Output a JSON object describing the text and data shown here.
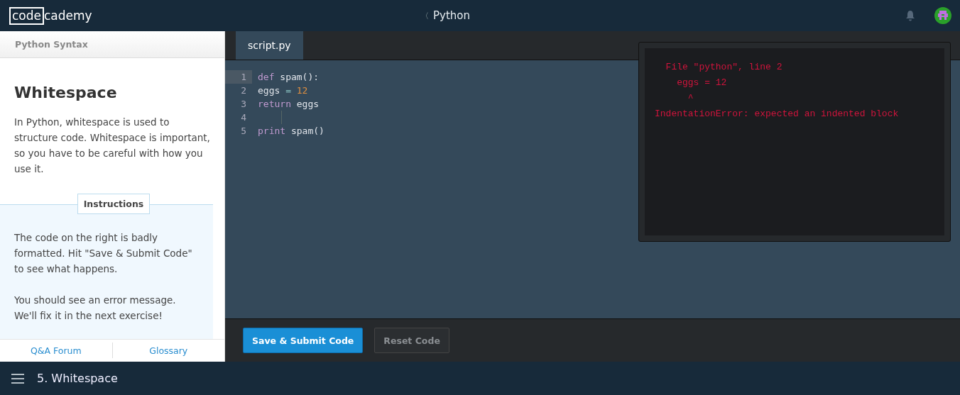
{
  "header": {
    "logo": [
      "code",
      "cademy"
    ],
    "course": "Python",
    "back_icon": "〈"
  },
  "lesson": {
    "unit": "Python Syntax",
    "title": "Whitespace",
    "body": "In Python, whitespace is used to structure code. Whitespace is important, so you have to be careful with how you use it.",
    "instructions_label": "Instructions",
    "instructions": [
      "The code on the right is badly formatted. Hit \"Save & Submit Code\" to see what happens.",
      "You should see an error message. We'll fix it in the next exercise!"
    ],
    "links": [
      "Q&A Forum",
      "Glossary"
    ]
  },
  "editor": {
    "tabs": [
      {
        "label": "script.py",
        "selected": true
      }
    ],
    "lines": [
      {
        "number": "1",
        "current": true,
        "tokens": [
          {
            "kind": "keyword",
            "text": "def"
          },
          {
            "kind": "plain",
            "text": " spam():"
          }
        ]
      },
      {
        "number": "2",
        "current": false,
        "tokens": [
          {
            "kind": "plain",
            "text": "eggs "
          },
          {
            "kind": "operator",
            "text": "="
          },
          {
            "kind": "number",
            "text": " 12"
          }
        ]
      },
      {
        "number": "3",
        "current": false,
        "tokens": [
          {
            "kind": "keyword",
            "text": "return"
          },
          {
            "kind": "plain",
            "text": " eggs"
          }
        ]
      },
      {
        "number": "4",
        "current": false
      },
      {
        "number": "5",
        "current": false,
        "tokens": [
          {
            "kind": "keyword",
            "text": "print"
          },
          {
            "kind": "plain",
            "text": " spam()"
          }
        ]
      }
    ],
    "output": [
      "  File \"python\", line 2",
      "    eggs = 12",
      "      ^",
      "IndentationError: expected an indented block"
    ],
    "buttons": [
      {
        "label": "Save & Submit Code",
        "kind": "primary"
      },
      {
        "label": "Reset Code",
        "kind": "secondary"
      }
    ]
  },
  "footer": {
    "exercise": "5. Whitespace"
  }
}
